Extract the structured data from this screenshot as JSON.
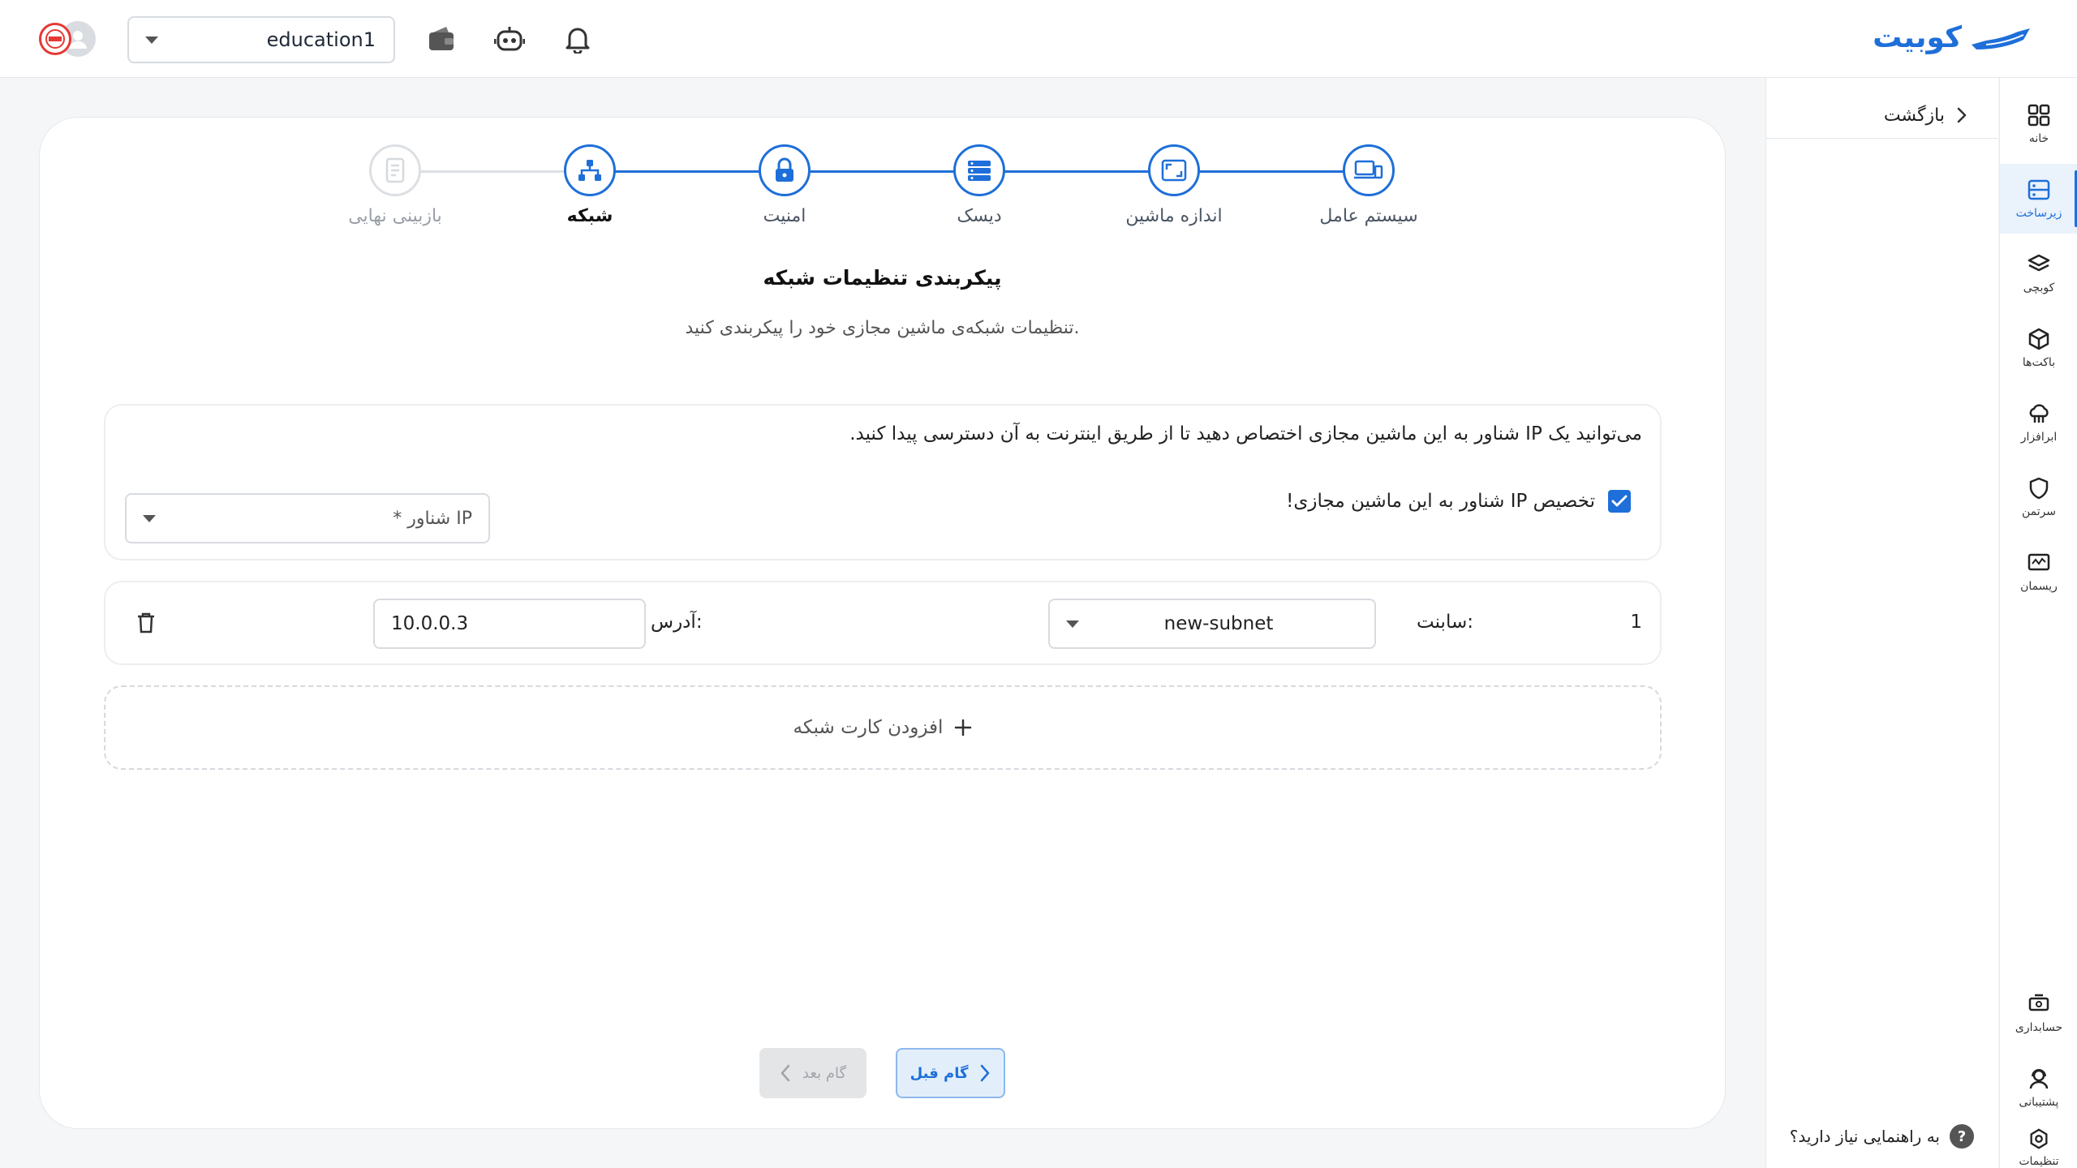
{
  "header": {
    "logo_text": "کوبیت",
    "project": "education1",
    "icons": [
      "wallet-icon",
      "robot-icon",
      "bell-icon"
    ]
  },
  "nav": {
    "items": [
      {
        "label": "خانه",
        "icon": "grid-icon"
      },
      {
        "label": "زیرساخت",
        "icon": "server-icon",
        "active": true
      },
      {
        "label": "کوبچی",
        "icon": "layers-icon"
      },
      {
        "label": "باکت‌ها",
        "icon": "box-icon"
      },
      {
        "label": "ابرافزار",
        "icon": "cloud-icon"
      },
      {
        "label": "سرتمن",
        "icon": "shield-icon"
      },
      {
        "label": "ریسمان",
        "icon": "monitor-icon"
      }
    ],
    "bottom_items": [
      {
        "label": "حسابداری",
        "icon": "accounting-icon"
      },
      {
        "label": "پشتیبانی",
        "icon": "support-icon"
      },
      {
        "label": "تنظیمات",
        "icon": "settings-icon"
      }
    ]
  },
  "panel": {
    "back_label": "بازگشت",
    "help_label": "به راهنمایی نیاز دارید؟"
  },
  "stepper": {
    "steps": [
      {
        "label": "سیستم عامل",
        "state": "done"
      },
      {
        "label": "اندازه ماشین",
        "state": "done"
      },
      {
        "label": "دیسک",
        "state": "done"
      },
      {
        "label": "امنیت",
        "state": "done"
      },
      {
        "label": "شبکه",
        "state": "current"
      },
      {
        "label": "بازبینی نهایی",
        "state": "future"
      }
    ]
  },
  "main": {
    "title": "پیکربندی تنظیمات شبکه",
    "subtitle": "تنظیمات شبکه‌ی ماشین مجازی خود را پیکربندی کنید.",
    "floating_ip": {
      "description": "می‌توانید یک IP شناور به این ماشین مجازی اختصاص دهید تا از طریق اینترنت به آن دسترسی پیدا کنید.",
      "checkbox_label": "تخصیص IP شناور به این ماشین مجازی!",
      "checked": true,
      "select_placeholder": "IP شناور *"
    },
    "nic": {
      "index": "1",
      "subnet_label": "سابنت:",
      "subnet_value": "new-subnet",
      "address_label": "آدرس:",
      "address_value": "10.0.0.3"
    },
    "add_nic_label": "افزودن کارت شبکه",
    "prev_label": "گام قبل",
    "next_label": "گام بعد"
  },
  "colors": {
    "accent": "#1e6fd9",
    "muted": "#dcdfe3"
  }
}
